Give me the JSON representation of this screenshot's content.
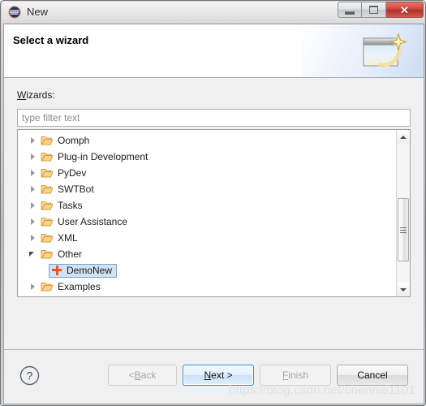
{
  "window": {
    "title": "New",
    "app_icon": "eclipse-icon",
    "controls": {
      "minimize_label": "",
      "maximize_label": "",
      "close_label": "✕"
    }
  },
  "banner": {
    "title": "Select a wizard",
    "icon": "wizard-sparkle-icon"
  },
  "body": {
    "wizards_label_pre": "W",
    "wizards_label_post": "izards:",
    "filter": {
      "value": "",
      "placeholder": "type filter text"
    }
  },
  "tree": {
    "items": [
      {
        "label": "Oomph",
        "icon": "folder-icon",
        "state": "collapsed",
        "level": 0,
        "selected": false
      },
      {
        "label": "Plug-in Development",
        "icon": "folder-icon",
        "state": "collapsed",
        "level": 0,
        "selected": false
      },
      {
        "label": "PyDev",
        "icon": "folder-icon",
        "state": "collapsed",
        "level": 0,
        "selected": false
      },
      {
        "label": "SWTBot",
        "icon": "folder-icon",
        "state": "collapsed",
        "level": 0,
        "selected": false
      },
      {
        "label": "Tasks",
        "icon": "folder-icon",
        "state": "collapsed",
        "level": 0,
        "selected": false
      },
      {
        "label": "User Assistance",
        "icon": "folder-icon",
        "state": "collapsed",
        "level": 0,
        "selected": false
      },
      {
        "label": "XML",
        "icon": "folder-icon",
        "state": "collapsed",
        "level": 0,
        "selected": false
      },
      {
        "label": "Other",
        "icon": "folder-icon",
        "state": "expanded",
        "level": 0,
        "selected": false
      },
      {
        "label": "DemoNew",
        "icon": "plus-icon",
        "state": "leaf",
        "level": 1,
        "selected": true
      },
      {
        "label": "Examples",
        "icon": "folder-icon",
        "state": "collapsed",
        "level": 0,
        "selected": false
      }
    ],
    "scrollbar": {
      "up_arrow": "scroll-up-icon",
      "down_arrow": "scroll-down-icon",
      "thumb_position_pct": 48
    }
  },
  "footer": {
    "help_icon": "help-question-icon",
    "buttons": [
      {
        "id": "back",
        "label_pre": "< ",
        "mnemonic": "B",
        "label_post": "ack",
        "state": "disabled"
      },
      {
        "id": "next",
        "label_pre": "",
        "mnemonic": "N",
        "label_post": "ext >",
        "state": "default"
      },
      {
        "id": "finish",
        "label_pre": "",
        "mnemonic": "F",
        "label_post": "inish",
        "state": "disabled"
      },
      {
        "id": "cancel",
        "label_pre": "",
        "mnemonic": "",
        "label_post": "Cancel",
        "state": "normal"
      }
    ]
  },
  "watermark": {
    "text": "https://blog.csdn.net/chennai1101"
  },
  "colors": {
    "accent_blue": "#2d8bd2",
    "selection_bg": "#cfe3f6",
    "selection_border": "#7da2c4",
    "plus_red": "#e8572a",
    "folder_orange": "#f0b357",
    "dialog_bg": "#f0f0f0",
    "close_red": "#d2453c"
  }
}
